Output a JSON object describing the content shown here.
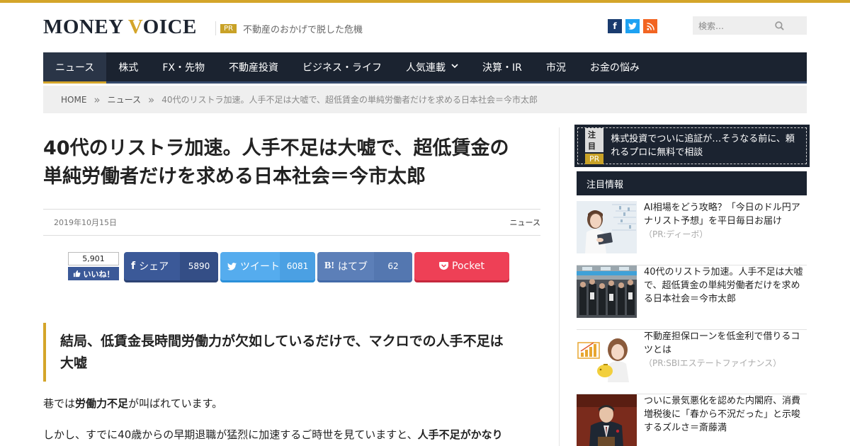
{
  "header": {
    "logo_main": "MONEY ",
    "logo_accent": "V",
    "logo_rest": "OICE",
    "pr_tag": "PR",
    "pr_text": "不動産のおかげで脱した危機",
    "social": {
      "facebook": "f",
      "twitter": "t",
      "rss": "r"
    },
    "search_placeholder": "検索…"
  },
  "nav": {
    "items": [
      {
        "label": "ニュース",
        "active": true
      },
      {
        "label": "株式"
      },
      {
        "label": "FX・先物"
      },
      {
        "label": "不動産投資"
      },
      {
        "label": "ビジネス・ライフ"
      },
      {
        "label": "人気連載",
        "has_dropdown": true
      },
      {
        "label": "決算・IR"
      },
      {
        "label": "市況"
      },
      {
        "label": "お金の悩み"
      }
    ]
  },
  "breadcrumb": {
    "home": "HOME",
    "section": "ニュース",
    "separator": "»",
    "current": "40代のリストラ加速。人手不足は大嘘で、超低賃金の単純労働者だけを求める日本社会＝今市太郎"
  },
  "article": {
    "title_line1": "40代のリストラ加速。人手不足は大嘘で、超低賃金の",
    "title_line2": "単純労働者だけを求める日本社会＝今市太郎",
    "date": "2019年10月15日",
    "category": "ニュース",
    "lead_line1": "結局、低賃金長時間労働力が欠如しているだけで、マクロでの人手不足は",
    "lead_line2": "大嘘",
    "para1_pre": "巷では",
    "para1_bold": "労働力不足",
    "para1_post": "が叫ばれています。",
    "para2_pre": "しかし、すでに40歳からの早期退職が猛烈に加速するご時世を見ていますと、",
    "para2_bold": "人手不足がかなり"
  },
  "share": {
    "like_count": "5,901",
    "like_label": "いいね！",
    "facebook_label": "シェア",
    "facebook_count": "5890",
    "twitter_label": "ツイート",
    "twitter_count": "6081",
    "hatena_label": "はてブ",
    "hatena_count": "62",
    "pocket_label": "Pocket"
  },
  "sidebar": {
    "notice_tag": "注目",
    "notice_pr": "PR",
    "notice_text": "株式投資でついに追証が…そうなる前に、頼れるプロに無料で相談",
    "widget_title": "注目情報",
    "items": [
      {
        "title": "AI相場をどう攻略？「今日のドル円アナリスト予想」を平日毎日お届け",
        "sponsor": "（PR:ディーボ）"
      },
      {
        "title": "40代のリストラ加速。人手不足は大嘘で、超低賃金の単純労働者だけを求める日本社会＝今市太郎",
        "sponsor": ""
      },
      {
        "title": "不動産担保ローンを低金利で借りるコツとは",
        "sponsor": "（PR:SBIエステートファイナンス）"
      },
      {
        "title": "ついに景気悪化を認めた内閣府、消費増税後に「春から不況だった」と示唆するズルさ＝斎藤満",
        "sponsor": ""
      }
    ]
  },
  "colors": {
    "accent_gold": "#d4a52a",
    "nav_dark": "#1b2330",
    "facebook": "#3b5998",
    "twitter": "#55acee",
    "hatena": "#5c7fb8",
    "pocket": "#ee4056"
  }
}
